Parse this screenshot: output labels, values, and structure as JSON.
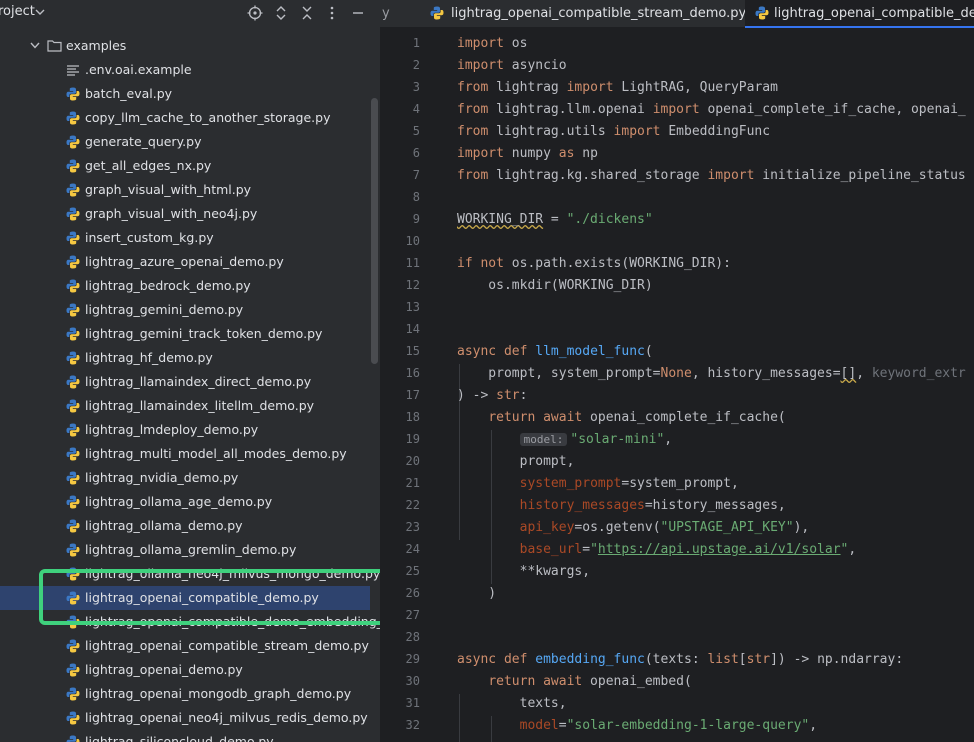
{
  "project_panel": {
    "title": "roject",
    "folder": "examples",
    "files": [
      {
        "name": ".env.oai.example",
        "icon": "text-file-icon"
      },
      {
        "name": "batch_eval.py",
        "icon": "python-file-icon"
      },
      {
        "name": "copy_llm_cache_to_another_storage.py",
        "icon": "python-file-icon"
      },
      {
        "name": "generate_query.py",
        "icon": "python-file-icon"
      },
      {
        "name": "get_all_edges_nx.py",
        "icon": "python-file-icon"
      },
      {
        "name": "graph_visual_with_html.py",
        "icon": "python-file-icon"
      },
      {
        "name": "graph_visual_with_neo4j.py",
        "icon": "python-file-icon"
      },
      {
        "name": "insert_custom_kg.py",
        "icon": "python-file-icon"
      },
      {
        "name": "lightrag_azure_openai_demo.py",
        "icon": "python-file-icon"
      },
      {
        "name": "lightrag_bedrock_demo.py",
        "icon": "python-file-icon"
      },
      {
        "name": "lightrag_gemini_demo.py",
        "icon": "python-file-icon"
      },
      {
        "name": "lightrag_gemini_track_token_demo.py",
        "icon": "python-file-icon"
      },
      {
        "name": "lightrag_hf_demo.py",
        "icon": "python-file-icon"
      },
      {
        "name": "lightrag_llamaindex_direct_demo.py",
        "icon": "python-file-icon"
      },
      {
        "name": "lightrag_llamaindex_litellm_demo.py",
        "icon": "python-file-icon"
      },
      {
        "name": "lightrag_lmdeploy_demo.py",
        "icon": "python-file-icon"
      },
      {
        "name": "lightrag_multi_model_all_modes_demo.py",
        "icon": "python-file-icon"
      },
      {
        "name": "lightrag_nvidia_demo.py",
        "icon": "python-file-icon"
      },
      {
        "name": "lightrag_ollama_age_demo.py",
        "icon": "python-file-icon"
      },
      {
        "name": "lightrag_ollama_demo.py",
        "icon": "python-file-icon"
      },
      {
        "name": "lightrag_ollama_gremlin_demo.py",
        "icon": "python-file-icon"
      },
      {
        "name": "lightrag_ollama_neo4j_milvus_mongo_demo.py",
        "icon": "python-file-icon"
      },
      {
        "name": "lightrag_openai_compatible_demo.py",
        "icon": "python-file-icon",
        "selected": true
      },
      {
        "name": "lightrag_openai_compatible_demo_embedding_cac",
        "icon": "python-file-icon"
      },
      {
        "name": "lightrag_openai_compatible_stream_demo.py",
        "icon": "python-file-icon"
      },
      {
        "name": "lightrag_openai_demo.py",
        "icon": "python-file-icon"
      },
      {
        "name": "lightrag_openai_mongodb_graph_demo.py",
        "icon": "python-file-icon"
      },
      {
        "name": "lightrag_openai_neo4j_milvus_redis_demo.py",
        "icon": "python-file-icon"
      },
      {
        "name": "lightrag_siliconcloud_demo.py",
        "icon": "python-file-icon"
      }
    ]
  },
  "editor_tabs": [
    {
      "label": "y",
      "active": false
    },
    {
      "label": "lightrag_openai_compatible_stream_demo.py",
      "active": false
    },
    {
      "label": "lightrag_openai_compatible_demo",
      "active": true
    }
  ],
  "code_lines": [
    {
      "n": "1",
      "html": "<span class='kw'>import</span> os"
    },
    {
      "n": "2",
      "html": "<span class='kw'>import</span> asyncio"
    },
    {
      "n": "3",
      "html": "<span class='kw'>from</span> lightrag <span class='kw'>import</span> LightRAG, QueryParam"
    },
    {
      "n": "4",
      "html": "<span class='kw'>from</span> lightrag.llm.openai <span class='kw'>import</span> openai_complete_if_cache, openai_"
    },
    {
      "n": "5",
      "html": "<span class='kw'>from</span> lightrag.utils <span class='kw'>import</span> EmbeddingFunc"
    },
    {
      "n": "6",
      "html": "<span class='kw'>import</span> numpy <span class='kw'>as</span> np"
    },
    {
      "n": "7",
      "html": "<span class='kw'>from</span> lightrag.kg.shared_storage <span class='kw'>import</span> initialize_pipeline_status"
    },
    {
      "n": "8",
      "html": ""
    },
    {
      "n": "9",
      "html": "<span class='squiggle'>WORKING_DIR</span> = <span class='str'>\"./dickens\"</span>"
    },
    {
      "n": "10",
      "html": ""
    },
    {
      "n": "11",
      "html": "<span class='kw'>if not</span> os.path.exists(WORKING_DIR):"
    },
    {
      "n": "12",
      "html": "    os.mkdir(WORKING_DIR)"
    },
    {
      "n": "13",
      "html": ""
    },
    {
      "n": "14",
      "html": ""
    },
    {
      "n": "15",
      "html": "<span class='kw'>async def</span> <span class='fn'>llm_model_func</span>("
    },
    {
      "n": "16",
      "html": "    prompt, system_prompt=<span class='kw'>None</span>, history_messages=<span class='squiggle'>[]</span>, <span class='hint'>keyword_extr</span>"
    },
    {
      "n": "17",
      "html": ") -> <span class='kw'>str</span>:"
    },
    {
      "n": "18",
      "html": "    <span class='kw'>return await</span> openai_complete_if_cache("
    },
    {
      "n": "19",
      "html": "        <span class='inlay'>model:</span><span class='str'>\"solar-mini\"</span>,"
    },
    {
      "n": "20",
      "html": "        prompt,"
    },
    {
      "n": "21",
      "html": "        <span class='param'>system_prompt</span>=system_prompt,"
    },
    {
      "n": "22",
      "html": "        <span class='param'>history_messages</span>=history_messages,"
    },
    {
      "n": "23",
      "html": "        <span class='param'>api_key</span>=os.getenv(<span class='str'>\"UPSTAGE_API_KEY\"</span>),"
    },
    {
      "n": "24",
      "html": "        <span class='param'>base_url</span>=<span class='str'>\"</span><span class='url'>https://api.upstage.ai/v1/solar</span><span class='str'>\"</span>,"
    },
    {
      "n": "25",
      "html": "        **kwargs,"
    },
    {
      "n": "26",
      "html": "    )"
    },
    {
      "n": "27",
      "html": ""
    },
    {
      "n": "28",
      "html": ""
    },
    {
      "n": "29",
      "html": "<span class='kw'>async def</span> <span class='fn'>embedding_func</span>(texts: <span class='kw'>list</span>[<span class='kw'>str</span>]) -> np.ndarray:"
    },
    {
      "n": "30",
      "html": "    <span class='kw'>return await</span> openai_embed("
    },
    {
      "n": "31",
      "html": "        texts,"
    },
    {
      "n": "32",
      "html": "        <span class='param'>model</span>=<span class='str'>\"solar-embedding-1-large-query\"</span>,"
    }
  ]
}
